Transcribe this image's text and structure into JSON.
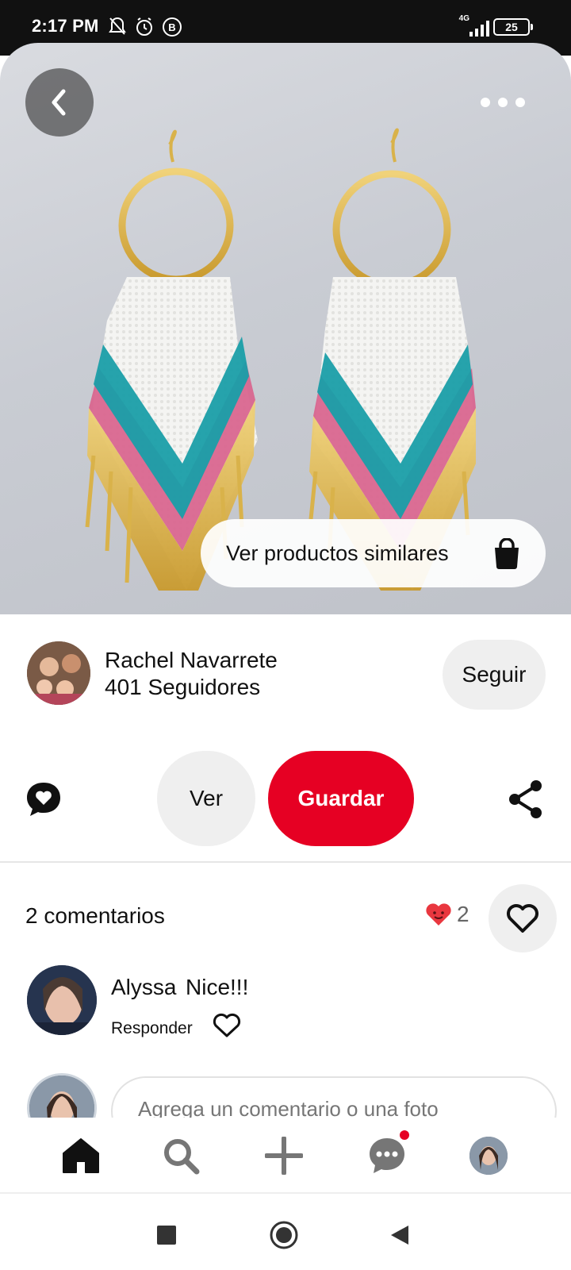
{
  "status_bar": {
    "time": "2:17 PM",
    "network": "4G",
    "battery": "25",
    "icons": [
      "mute-bell-icon",
      "alarm-icon",
      "b-badge-icon",
      "signal-icon",
      "battery-icon"
    ]
  },
  "hero": {
    "image_subject": "beaded fringe hoop earrings",
    "similar_products_label": "Ver productos similares",
    "icons": [
      "back-arrow-icon",
      "more-options-icon",
      "shopping-bag-icon"
    ]
  },
  "creator": {
    "name": "Rachel Navarrete",
    "followers": "401 Seguidores",
    "follow_label": "Seguir"
  },
  "actions": {
    "view_label": "Ver",
    "save_label": "Guardar",
    "accent_color": "#e60023",
    "icons": [
      "comment-heart-icon",
      "share-icon"
    ]
  },
  "comments": {
    "count_label": "2 comentarios",
    "reactions_count": "2",
    "items": [
      {
        "author": "Alyssa",
        "text": "Nice!!!",
        "reply_label": "Responder"
      }
    ],
    "add_placeholder": "Agrega un comentario o una foto"
  },
  "bottom_nav": {
    "items": [
      "home-icon",
      "search-icon",
      "create-icon",
      "messages-icon",
      "profile-avatar"
    ],
    "messages_has_notification": true
  },
  "system_nav": [
    "recents-icon",
    "home-circle-icon",
    "back-triangle-icon"
  ]
}
